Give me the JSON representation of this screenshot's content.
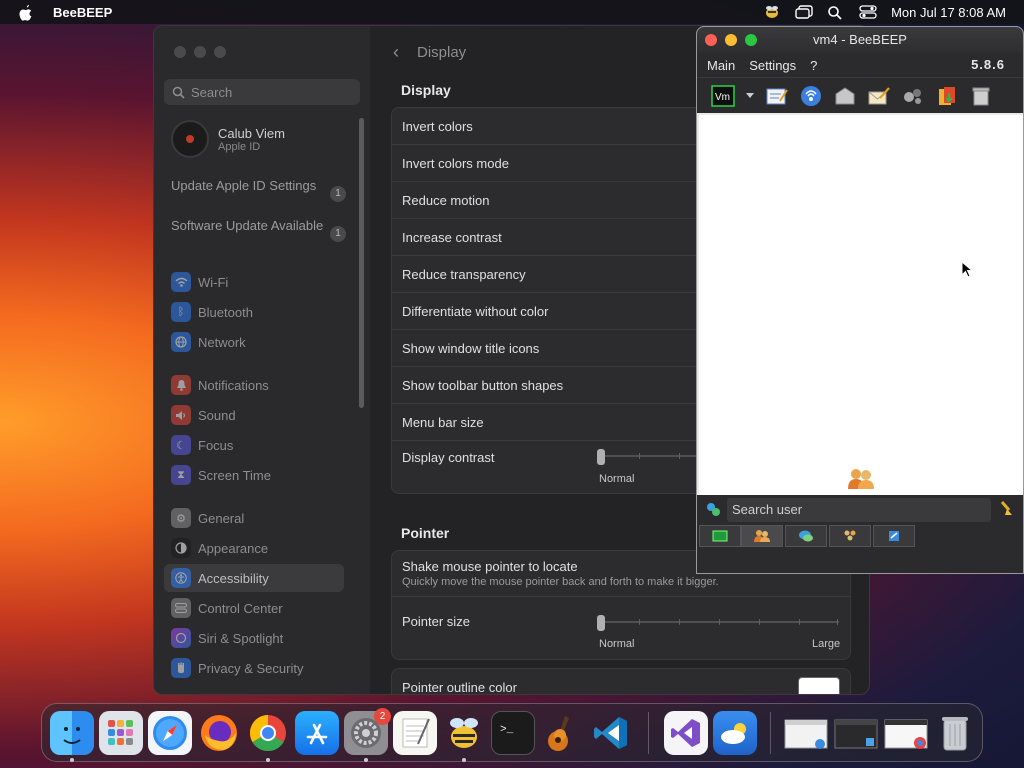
{
  "menubar": {
    "app_name": "BeeBEEP",
    "clock": "Mon Jul 17  8:08 AM"
  },
  "settings": {
    "search_placeholder": "Search",
    "account": {
      "name": "Calub Viem",
      "subtitle": "Apple ID"
    },
    "updates": [
      {
        "label": "Update Apple ID Settings",
        "count": "1"
      },
      {
        "label": "Software Update Available",
        "count": "1"
      }
    ],
    "sidebar": [
      {
        "label": "Wi-Fi",
        "icon": "wifi-icon",
        "color": "#2f7ef6"
      },
      {
        "label": "Bluetooth",
        "icon": "bluetooth-icon",
        "color": "#2f7ef6"
      },
      {
        "label": "Network",
        "icon": "network-icon",
        "color": "#2f7ef6"
      },
      {
        "label": "Notifications",
        "icon": "bell-icon",
        "color": "#e5483c"
      },
      {
        "label": "Sound",
        "icon": "speaker-icon",
        "color": "#e5483c"
      },
      {
        "label": "Focus",
        "icon": "moon-icon",
        "color": "#5e5ce6"
      },
      {
        "label": "Screen Time",
        "icon": "hourglass-icon",
        "color": "#5e5ce6"
      },
      {
        "label": "General",
        "icon": "gear-icon",
        "color": "#8e8e93"
      },
      {
        "label": "Appearance",
        "icon": "appearance-icon",
        "color": "#1c1c1e"
      },
      {
        "label": "Accessibility",
        "icon": "accessibility-icon",
        "color": "#2f7ef6"
      },
      {
        "label": "Control Center",
        "icon": "control-center-icon",
        "color": "#8e8e93"
      },
      {
        "label": "Siri & Spotlight",
        "icon": "siri-icon",
        "color": "#c644fc"
      },
      {
        "label": "Privacy & Security",
        "icon": "hand-icon",
        "color": "#2f7ef6"
      }
    ],
    "header": {
      "title": "Display"
    },
    "display_section": {
      "title": "Display",
      "rows": [
        "Invert colors",
        "Invert colors mode",
        "Reduce motion",
        "Increase contrast",
        "Reduce transparency",
        "Differentiate without color",
        "Show window title icons",
        "Show toolbar button shapes",
        "Menu bar size",
        "Display contrast"
      ],
      "contrast_min_label": "Normal",
      "contrast_level": 0
    },
    "pointer_section": {
      "title": "Pointer",
      "shake_title": "Shake mouse pointer to locate",
      "shake_desc": "Quickly move the mouse pointer back and forth to make it bigger.",
      "size_label": "Pointer size",
      "size_min": "Normal",
      "size_max": "Large",
      "size_level": 0,
      "outline_label": "Pointer outline color",
      "outline_color": "#ffffff"
    }
  },
  "beebeep": {
    "title": "vm4 - BeeBEEP",
    "menus": [
      "Main",
      "Settings",
      "?"
    ],
    "version": "5.8.6",
    "search_placeholder": "Search user"
  }
}
